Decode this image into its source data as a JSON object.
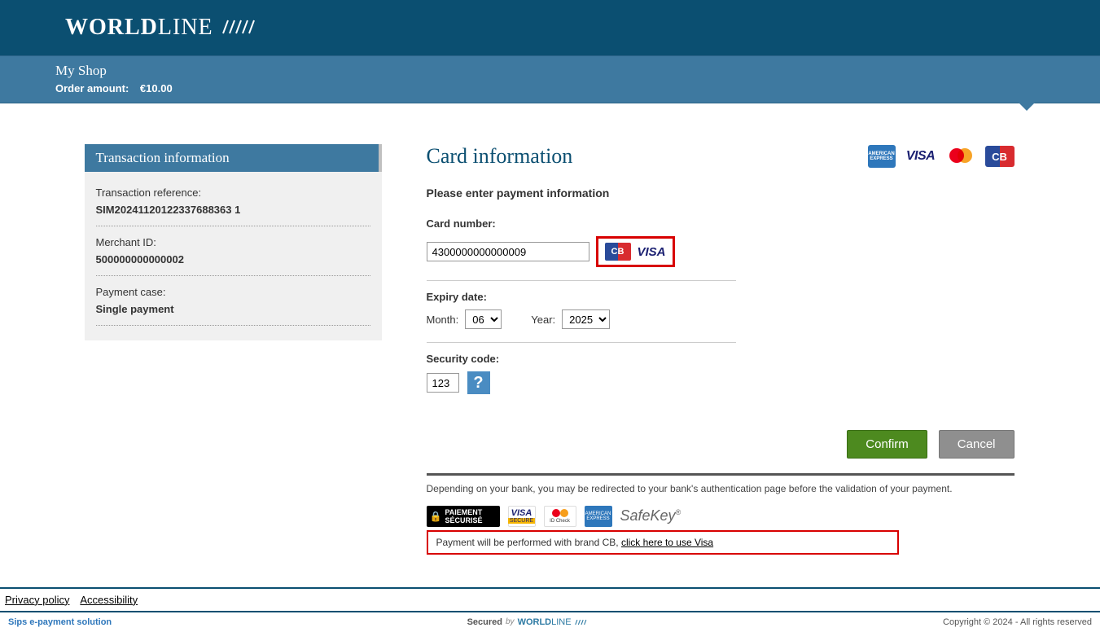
{
  "brand": {
    "name_bold": "WORLD",
    "name_light": "LINE"
  },
  "orderbar": {
    "shop_name": "My Shop",
    "amount_label": "Order amount:",
    "amount_value": "€10.00"
  },
  "sidebar": {
    "heading": "Transaction information",
    "rows": [
      {
        "label": "Transaction reference:",
        "value": "SIM20241120122337688363 1"
      },
      {
        "label": "Merchant ID:",
        "value": "500000000000002"
      },
      {
        "label": "Payment case:",
        "value": "Single payment"
      }
    ]
  },
  "card_logos_top": [
    "amex",
    "visa",
    "mastercard",
    "cb"
  ],
  "page_title": "Card information",
  "subtitle": "Please enter payment information",
  "form": {
    "card_number_label": "Card number:",
    "card_number_value": "4300000000000009",
    "detected_brands": [
      "cb",
      "visa"
    ],
    "expiry_label": "Expiry date:",
    "month_label": "Month:",
    "month_value": "06",
    "year_label": "Year:",
    "year_value": "2025",
    "security_label": "Security code:",
    "security_value": "123"
  },
  "actions": {
    "confirm": "Confirm",
    "cancel": "Cancel"
  },
  "note": "Depending on your bank, you may be redirected to your bank's authentication page before the validation of your payment.",
  "security_badges": {
    "paiement_securise": "PAIEMENT SÉCURISÉ",
    "safekey": "SafeKey",
    "idcheck": "ID Check"
  },
  "brand_switch": {
    "text": "Payment will be performed with brand CB, ",
    "link": "click here to use Visa"
  },
  "footer": {
    "links": [
      "Privacy policy",
      "Accessibility"
    ],
    "sips": "Sips e-payment solution",
    "secured": "Secured",
    "by": "by",
    "copyright": "Copyright © 2024 - All rights reserved"
  }
}
